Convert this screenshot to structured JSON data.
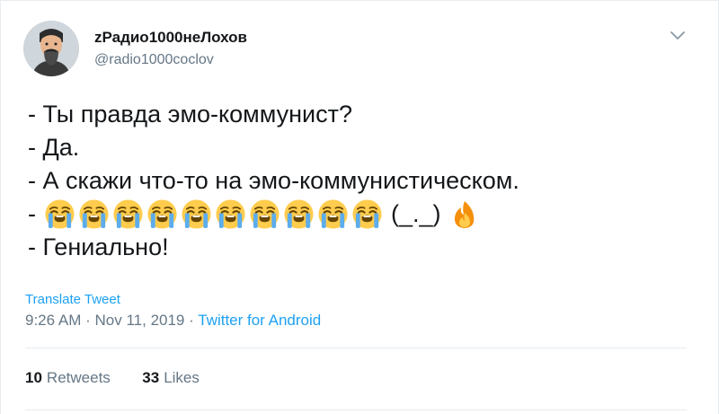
{
  "author": {
    "display_name": "zРадио1000неЛохов",
    "handle": "@radio1000coclov",
    "avatar_icon": "bearded-man-avatar"
  },
  "menu_icon": "chevron-down-icon",
  "tweet": {
    "lines": [
      "- Ты правда эмо-коммунист?",
      "- Да.",
      "- А скажи что-то на эмо-коммунистическом.",
      "- Гениально!"
    ],
    "emoji_line": {
      "prefix": "-",
      "crying_emoji_count": 10,
      "kaomoji": "(_._)",
      "trailing_emoji": "fire-emoji"
    }
  },
  "translate_label": "Translate Tweet",
  "meta": {
    "time": "9:26 AM",
    "separator": "·",
    "date": "Nov 11, 2019",
    "source": "Twitter for Android"
  },
  "stats": {
    "retweets_count": "10",
    "retweets_label": "Retweets",
    "likes_count": "33",
    "likes_label": "Likes"
  },
  "colors": {
    "link_blue": "#1da1f2",
    "secondary_gray": "#657786",
    "text_dark": "#14171a",
    "divider": "#e6ecf0"
  }
}
